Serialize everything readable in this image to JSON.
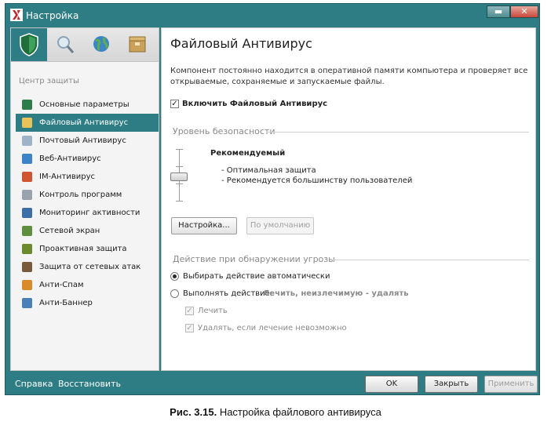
{
  "window": {
    "title": "Настройка",
    "accent": "#2f7d84"
  },
  "window_controls": {
    "minimize": "▬",
    "close": "✕"
  },
  "sidebar": {
    "section_title": "Центр защиты",
    "tabs": [
      {
        "icon": "shield-icon"
      },
      {
        "icon": "magnifier-icon"
      },
      {
        "icon": "globe-icon"
      },
      {
        "icon": "box-icon"
      }
    ],
    "items": [
      {
        "label": "Основные параметры",
        "icon": "shield-icon",
        "color": "#2d7d4a"
      },
      {
        "label": "Файловый Антивирус",
        "icon": "folder-icon",
        "color": "#e7c35a",
        "active": true
      },
      {
        "label": "Почтовый Антивирус",
        "icon": "mail-icon",
        "color": "#9fb3c8"
      },
      {
        "label": "Веб-Антивирус",
        "icon": "globe-icon",
        "color": "#3c84c8"
      },
      {
        "label": "IM-Антивирус",
        "icon": "chat-icon",
        "color": "#d0552f"
      },
      {
        "label": "Контроль программ",
        "icon": "filter-icon",
        "color": "#9aa3ad"
      },
      {
        "label": "Мониторинг активности",
        "icon": "monitor-icon",
        "color": "#3c6fa8"
      },
      {
        "label": "Сетевой экран",
        "icon": "firewall-icon",
        "color": "#5f8f3e"
      },
      {
        "label": "Проактивная защита",
        "icon": "shield-icon",
        "color": "#6c8a2c"
      },
      {
        "label": "Защита от сетевых атак",
        "icon": "network-icon",
        "color": "#7a5a3a"
      },
      {
        "label": "Анти-Спам",
        "icon": "envelope-icon",
        "color": "#d98a2b"
      },
      {
        "label": "Анти-Баннер",
        "icon": "banner-icon",
        "color": "#4a7fb8"
      }
    ]
  },
  "footer": {
    "help": "Справка",
    "restore": "Восстановить"
  },
  "main": {
    "title": "Файловый Антивирус",
    "description": "Компонент постоянно находится в оперативной памяти компьютера и проверяет все открываемые, сохраняемые и запускаемые файлы.",
    "enable_checkbox": {
      "label": "Включить Файловый Антивирус",
      "checked": true
    },
    "security_level": {
      "group_title": "Уровень безопасности",
      "level_name": "Рекомендуемый",
      "bullets": [
        "- Оптимальная защита",
        "- Рекомендуется большинству пользователей"
      ]
    },
    "buttons": {
      "settings": "Настройка...",
      "default": "По умолчанию"
    },
    "threat_action": {
      "group_title": "Действие при обнаружении угрозы",
      "option_auto": "Выбирать действие автоматически",
      "option_manual_prefix": "Выполнять действие:",
      "option_manual_value": "Лечить, неизлечимую - удалять",
      "cure_label": "Лечить",
      "delete_label": "Удалять, если лечение невозможно"
    }
  },
  "bottom_buttons": {
    "ok": "OK",
    "close": "Закрыть",
    "apply": "Применить"
  },
  "caption": {
    "bold": "Рис. 3.15.",
    "text": " Настройка файлового антивируса"
  }
}
